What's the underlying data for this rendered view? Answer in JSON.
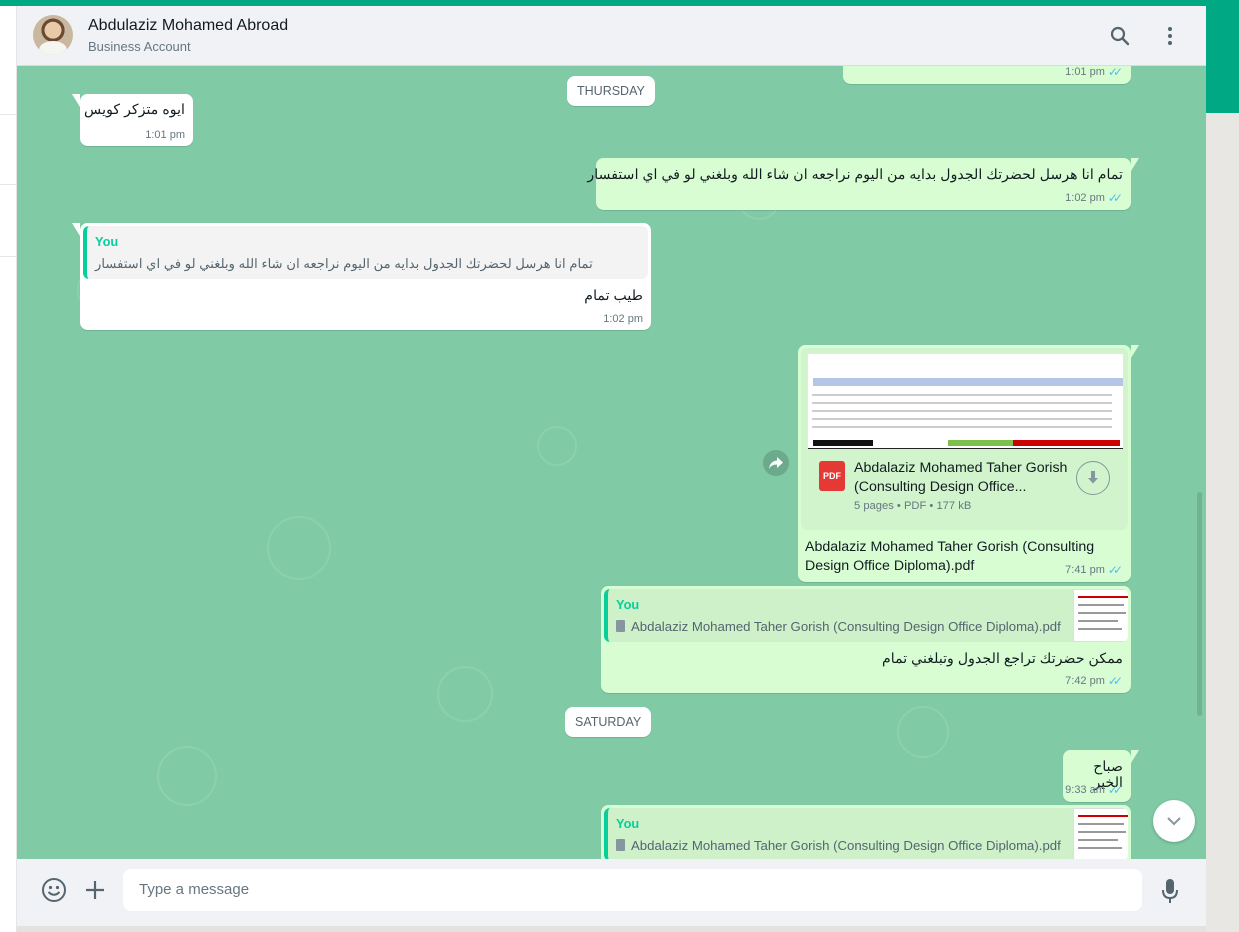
{
  "header": {
    "contact_name": "Abdulaziz Mohamed Abroad",
    "subtitle": "Business Account"
  },
  "dates": {
    "thursday": "THURSDAY",
    "saturday": "SATURDAY"
  },
  "messages": {
    "m0": {
      "time": "1:01 pm"
    },
    "m1": {
      "text": "ايوه متزكر كويس",
      "time": "1:01 pm"
    },
    "m2": {
      "text": "تمام انا هرسل لحضرتك الجدول بدايه من اليوم نراجعه ان شاء الله وبلغني لو في اي استفسار",
      "time": "1:02 pm"
    },
    "m3": {
      "quote_author": "You",
      "quote_text": "تمام انا هرسل لحضرتك الجدول بدايه من اليوم نراجعه ان شاء الله وبلغني لو في اي استفسار",
      "text": "طيب تمام",
      "time": "1:02 pm"
    },
    "m4": {
      "doc_name_line1": "Abdalaziz Mohamed Taher Gorish",
      "doc_name_line2": "(Consulting Design Office...",
      "doc_meta": "5 pages • PDF • 177 kB",
      "file_icon": "PDF",
      "caption_line1": "Abdalaziz Mohamed Taher Gorish (Consulting",
      "caption_line2": "Design Office Diploma).pdf",
      "time": "7:41 pm"
    },
    "m5": {
      "quote_author": "You",
      "quote_text": "Abdalaziz Mohamed Taher Gorish (Consulting Design Office Diploma).pdf",
      "text": "ممكن حضرتك تراجع الجدول وتبلغني تمام",
      "time": "7:42 pm"
    },
    "m6": {
      "text": "صباح الخير",
      "time": "9:33 am"
    },
    "m7": {
      "quote_author": "You",
      "quote_text": "Abdalaziz Mohamed Taher Gorish (Consulting Design Office Diploma).pdf"
    }
  },
  "composer": {
    "placeholder": "Type a message"
  },
  "icons": {
    "search": "search-icon",
    "menu": "menu-icon",
    "emoji": "emoji-icon",
    "attach": "plus-icon",
    "mic": "mic-icon",
    "forward": "forward-icon",
    "download": "download-icon",
    "scroll_down": "chevron-down-icon"
  },
  "colors": {
    "accent": "#00a884",
    "chat_bg": "#80cba5",
    "outgoing": "#d9fdd3",
    "incoming": "#ffffff",
    "read_ticks": "#53bdeb",
    "pdf_red": "#e53935"
  }
}
